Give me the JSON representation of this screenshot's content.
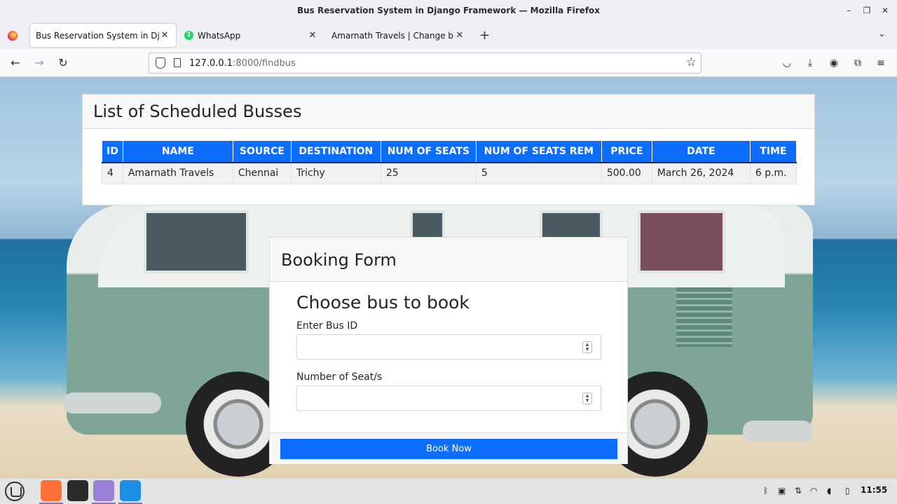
{
  "window": {
    "title": "Bus Reservation System in Django Framework — Mozilla Firefox",
    "minimize": "–",
    "maximize": "❐",
    "close": "✕"
  },
  "tabs": [
    {
      "label": "Bus Reservation System in Djang",
      "active": true
    },
    {
      "label": "WhatsApp",
      "badge": "1",
      "active": false
    },
    {
      "label": "Amarnath Travels | Change bus",
      "active": false
    }
  ],
  "tab_close_glyph": "✕",
  "new_tab_glyph": "+",
  "tab_list_glyph": "⌄",
  "nav": {
    "back": "←",
    "forward": "→",
    "reload": "↻",
    "url_host": "127.0.0.1",
    "url_rest": ":8000/findbus",
    "bookmark_star": "☆"
  },
  "toolbar_icons": [
    "pocket-icon",
    "download-icon",
    "account-icon",
    "extensions-icon",
    "menu-icon"
  ],
  "toolbar_glyphs": {
    "pocket": "◡",
    "download": "⤓",
    "account": "◉",
    "extensions": "⧉",
    "menu": "≡"
  },
  "schedule": {
    "title": "List of Scheduled Busses",
    "columns": [
      "ID",
      "NAME",
      "SOURCE",
      "DESTINATION",
      "NUM OF SEATS",
      "NUM OF SEATS REM",
      "PRICE",
      "DATE",
      "TIME"
    ],
    "rows": [
      [
        "4",
        "Amarnath Travels",
        "Chennai",
        "Trichy",
        "25",
        "5",
        "500.00",
        "March 26, 2024",
        "6 p.m."
      ]
    ]
  },
  "booking": {
    "title": "Booking Form",
    "subtitle": "Choose bus to book",
    "bus_id_label": "Enter Bus ID",
    "bus_id_value": "",
    "seats_label": "Number of Seat/s",
    "seats_value": "",
    "submit_label": "Book Now"
  },
  "taskbar": {
    "clock": "11:55",
    "apps": [
      "menu-icon",
      "firefox-icon",
      "terminal-icon",
      "files-icon",
      "vscode-icon"
    ]
  },
  "colors": {
    "primary": "#0d6efd",
    "firefox_orange": "#ff7139",
    "whatsapp_green": "#25d366"
  }
}
